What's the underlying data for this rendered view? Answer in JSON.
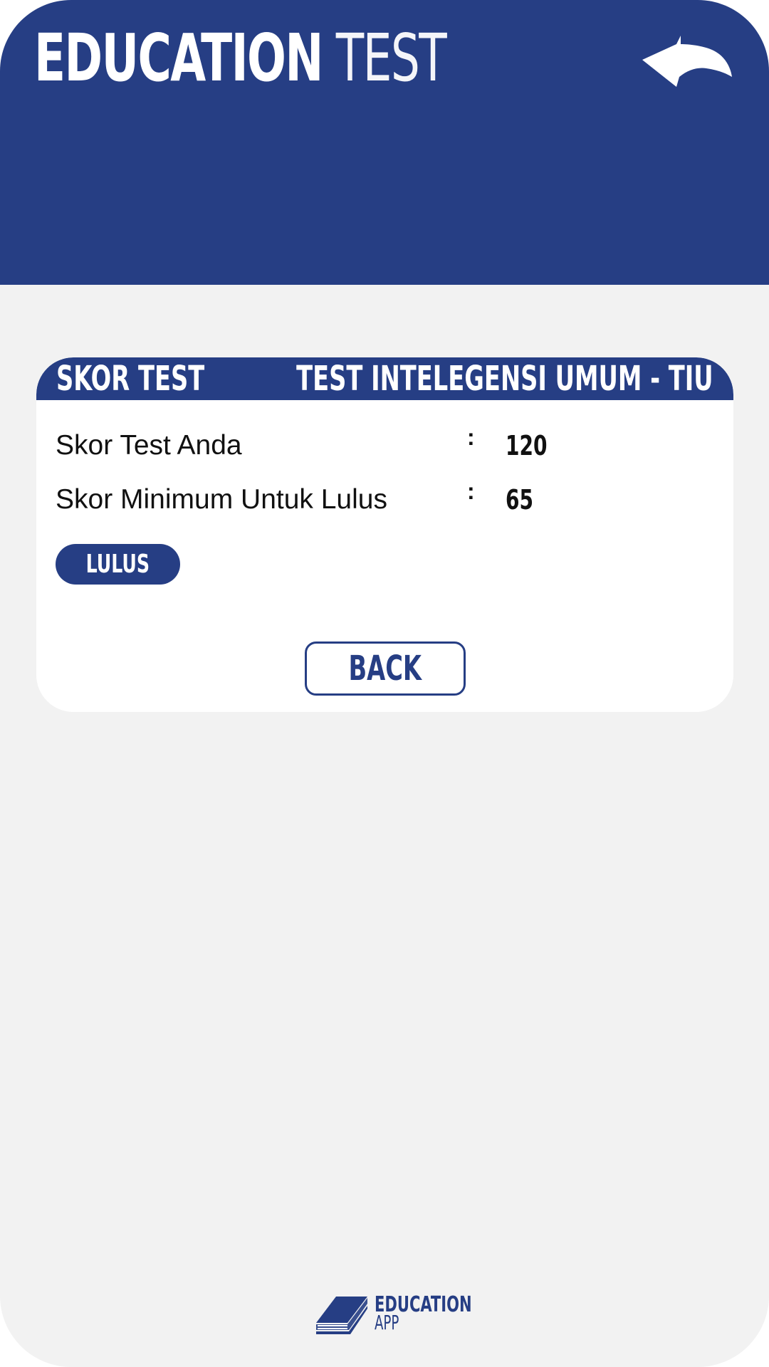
{
  "header": {
    "title_strong": "EDUCATION",
    "title_light": "TEST",
    "back_icon": "back-arrow-icon"
  },
  "card": {
    "header_left": "SKOR TEST",
    "header_right": "TEST INTELEGENSI UMUM - TIU",
    "rows": [
      {
        "label": "Skor Test Anda",
        "colon": ":",
        "value": "120"
      },
      {
        "label": "Skor Minimum Untuk Lulus",
        "colon": ":",
        "value": "65"
      }
    ],
    "status": "LULUS",
    "back_label": "BACK"
  },
  "footer": {
    "logo_name": "EDUCATION",
    "logo_sub": "APP",
    "logo_icon": "book-icon"
  },
  "colors": {
    "primary": "#263e84",
    "background": "#f2f2f2",
    "card": "#ffffff"
  }
}
